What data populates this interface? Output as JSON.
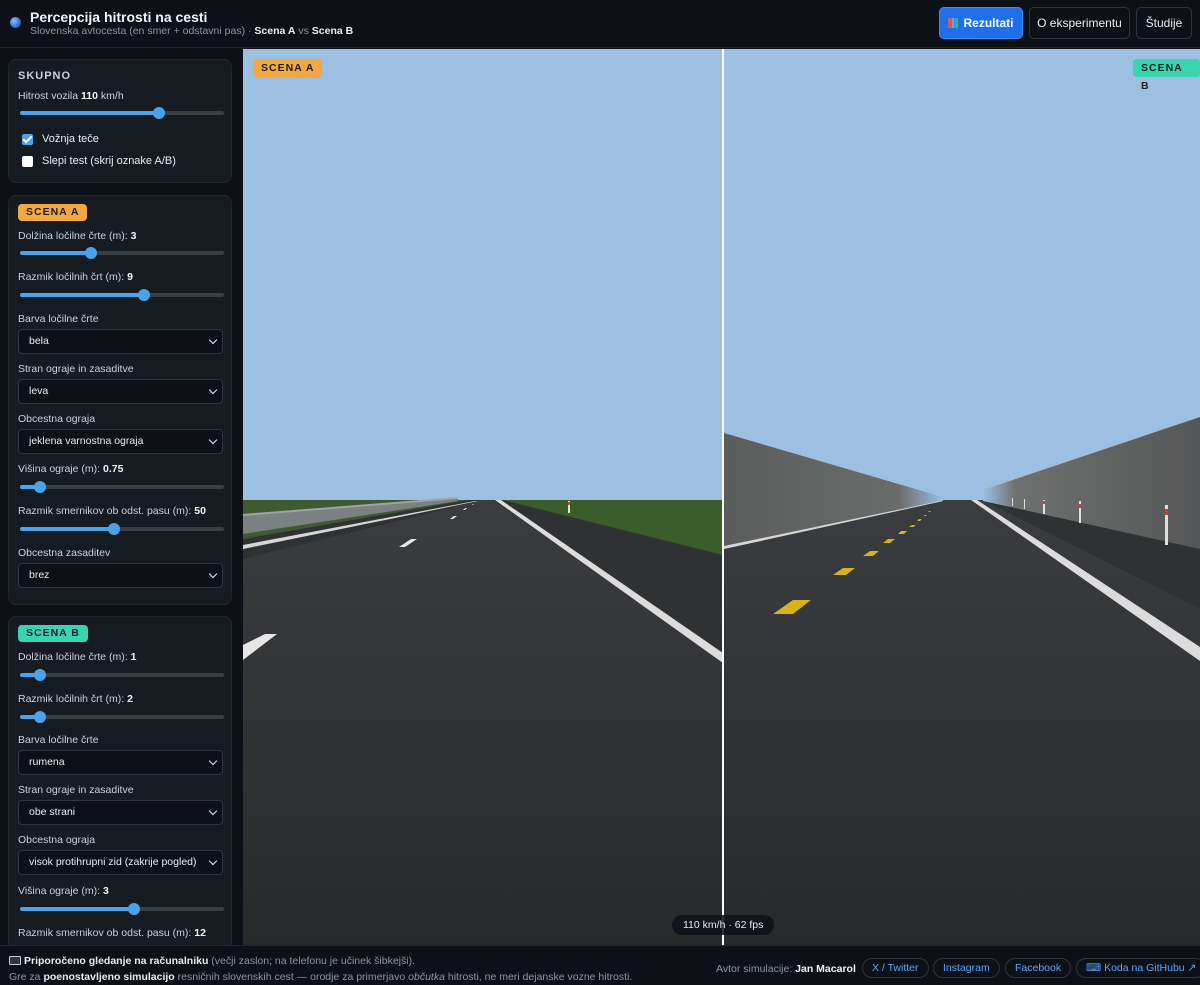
{
  "header": {
    "title": "Percepcija hitrosti na cesti",
    "subtitle_prefix": "Slovenska avtocesta (en smer + odstavni pas) · ",
    "subtitle_a": "Scena A",
    "subtitle_vs": " vs ",
    "subtitle_b": "Scena B",
    "buttons": {
      "results": "Rezultati",
      "about": "O eksperimentu",
      "studies": "Študije"
    }
  },
  "skupno": {
    "title": "SKUPNO",
    "speed_label": "Hitrost vozila",
    "speed_value": "110",
    "speed_unit": "km/h",
    "speed_fraction": 0.68,
    "driving_label": "Vožnja teče",
    "driving_checked": true,
    "blind_label": "Slepi test (skrij oznake A/B)",
    "blind_checked": false
  },
  "scene_a": {
    "tag": "SCENA A",
    "line_length_label": "Dolžina ločilne črte (m):",
    "line_length_value": "3",
    "line_length_fraction": 0.35,
    "line_gap_label": "Razmik ločilnih črt (m):",
    "line_gap_value": "9",
    "line_gap_fraction": 0.61,
    "line_color_label": "Barva ločilne črte",
    "line_color_value": "bela",
    "side_label": "Stran ograje in zasaditve",
    "side_value": "leva",
    "barrier_label": "Obcestna ograja",
    "barrier_value": "jeklena varnostna ograja",
    "barrier_height_label": "Višina ograje (m):",
    "barrier_height_value": "0.75",
    "barrier_height_fraction": 0.1,
    "marker_spacing_label": "Razmik smernikov ob odst. pasu (m):",
    "marker_spacing_value": "50",
    "marker_spacing_fraction": 0.46,
    "planting_label": "Obcestna zasaditev",
    "planting_value": "brez"
  },
  "scene_b": {
    "tag": "SCENA B",
    "line_length_label": "Dolžina ločilne črte (m):",
    "line_length_value": "1",
    "line_length_fraction": 0.1,
    "line_gap_label": "Razmik ločilnih črt (m):",
    "line_gap_value": "2",
    "line_gap_fraction": 0.1,
    "line_color_label": "Barva ločilne črte",
    "line_color_value": "rumena",
    "side_label": "Stran ograje in zasaditve",
    "side_value": "obe strani",
    "barrier_label": "Obcestna ograja",
    "barrier_value": "visok protihrupni zid (zakrije pogled)",
    "barrier_height_label": "Višina ograje (m):",
    "barrier_height_value": "3",
    "barrier_height_fraction": 0.56,
    "marker_spacing_label": "Razmik smernikov ob odst. pasu (m):",
    "marker_spacing_value": "12"
  },
  "viewport": {
    "tag_a": "SCENA A",
    "tag_b": "SCENA B",
    "fps_text": "110 km/h · 62 fps"
  },
  "footer": {
    "rec_bold": "Priporočeno gledanje na računalniku",
    "rec_rest": " (večji zaslon; na telefonu je učinek šibkejši).",
    "desc_pre": "Gre za ",
    "desc_bold": "poenostavljeno simulacijo",
    "desc_mid": " resničnih slovenskih cest — orodje za primerjavo ",
    "desc_italic": "občutka",
    "desc_post": " hitrosti, ne meri dejanske vozne hitrosti.",
    "author_label": "Avtor simulacije: ",
    "author_name": "Jan Macarol",
    "links": {
      "twitter": "X / Twitter",
      "instagram": "Instagram",
      "facebook": "Facebook",
      "github": "⌨ Koda na GitHubu ↗"
    }
  },
  "colors": {
    "accent": "#1f6feb",
    "tag_a": "#f5a742",
    "tag_b": "#39d5ae",
    "slider": "#4aa3ea",
    "sky": "#9dc0e2",
    "road": "#2f3133",
    "grass": "#3b5d2c"
  }
}
